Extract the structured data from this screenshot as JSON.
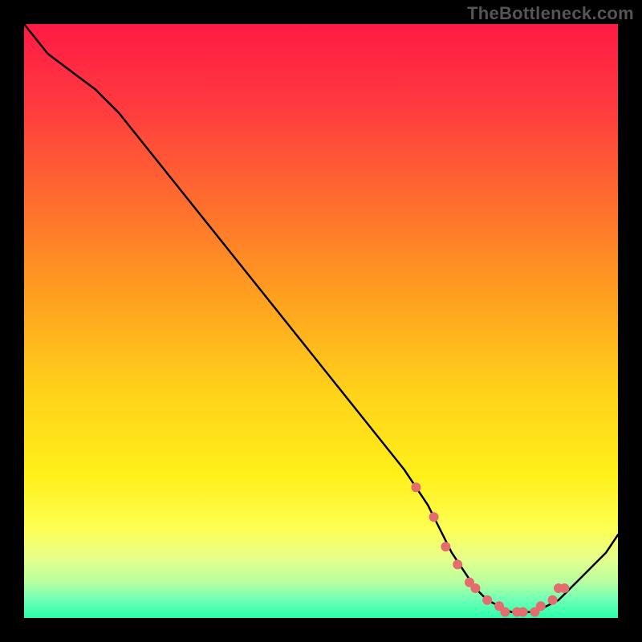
{
  "watermark": "TheBottleneck.com",
  "colors": {
    "background": "#000000",
    "line": "#000000",
    "marker_fill": "#e46c6c",
    "marker_stroke": "#e46c6c",
    "gradient_top": "#ff1a45",
    "gradient_mid": "#ffd21a",
    "gradient_bottom": "#2affa9"
  },
  "chart_data": {
    "type": "line",
    "title": "",
    "xlabel": "",
    "ylabel": "",
    "xlim": [
      0,
      100
    ],
    "ylim": [
      0,
      100
    ],
    "grid": false,
    "legend": false,
    "series": [
      {
        "name": "curve",
        "x": [
          0,
          4,
          8,
          12,
          16,
          20,
          24,
          28,
          32,
          36,
          40,
          44,
          48,
          52,
          56,
          60,
          64,
          66,
          68,
          70,
          72,
          74,
          76,
          78,
          80,
          82,
          84,
          86,
          88,
          90,
          92,
          94,
          96,
          98,
          100
        ],
        "y": [
          100,
          95,
          92,
          89,
          85,
          80,
          75,
          70,
          65,
          60,
          55,
          50,
          45,
          40,
          35,
          30,
          25,
          22,
          19,
          15,
          11,
          8,
          5,
          3,
          2,
          1,
          1,
          1,
          2,
          3,
          5,
          7,
          9,
          11,
          14
        ]
      }
    ],
    "markers": {
      "name": "highlight-points",
      "x": [
        66,
        69,
        71,
        73,
        75,
        76,
        78,
        80,
        81,
        83,
        84,
        86,
        87,
        89,
        90,
        91
      ],
      "y": [
        22,
        17,
        12,
        9,
        6,
        5,
        3,
        2,
        1,
        1,
        1,
        1,
        2,
        3,
        5,
        5
      ]
    }
  }
}
